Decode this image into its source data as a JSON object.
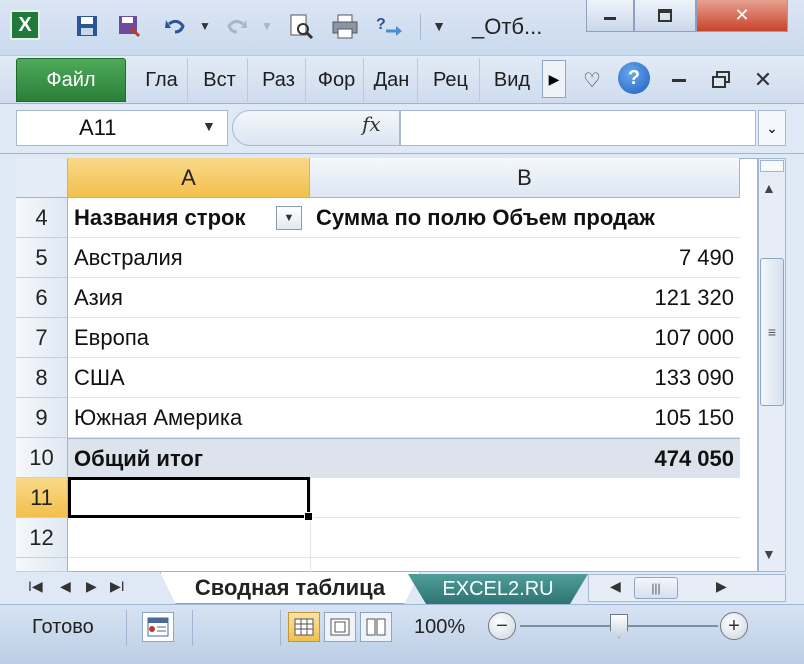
{
  "window": {
    "title": "_Отб...",
    "app_icon_letter": "X"
  },
  "ribbon": {
    "file_tab": "Файл",
    "tabs": [
      "Гла",
      "Вст",
      "Раз",
      "Фор",
      "Дан",
      "Рец",
      "Вид"
    ],
    "help": "?"
  },
  "formula_bar": {
    "name_box": "A11",
    "fx": "fx",
    "formula": ""
  },
  "columns": [
    "A",
    "B"
  ],
  "rows": [
    {
      "num": "4",
      "a": "Названия строк",
      "b": "Сумма по полю Объем продаж",
      "kind": "header"
    },
    {
      "num": "5",
      "a": "Австралия",
      "b": "7 490",
      "kind": "data"
    },
    {
      "num": "6",
      "a": "Азия",
      "b": "121 320",
      "kind": "data"
    },
    {
      "num": "7",
      "a": "Европа",
      "b": "107 000",
      "kind": "data"
    },
    {
      "num": "8",
      "a": "США",
      "b": "133 090",
      "kind": "data"
    },
    {
      "num": "9",
      "a": "Южная Америка",
      "b": "105 150",
      "kind": "data"
    },
    {
      "num": "10",
      "a": "Общий итог",
      "b": "474 050",
      "kind": "total"
    },
    {
      "num": "11",
      "a": "",
      "b": "",
      "kind": "selected"
    },
    {
      "num": "12",
      "a": "",
      "b": "",
      "kind": "empty"
    }
  ],
  "sheets": {
    "active": "Сводная таблица",
    "other": "EXCEL2.RU"
  },
  "status": {
    "ready": "Готово",
    "zoom": "100%"
  },
  "colors": {
    "file_tab": "#2a7f38",
    "selected_header": "#f2c04b",
    "total_row": "#dce3ec",
    "sheet_tab_2": "#2d7472"
  }
}
